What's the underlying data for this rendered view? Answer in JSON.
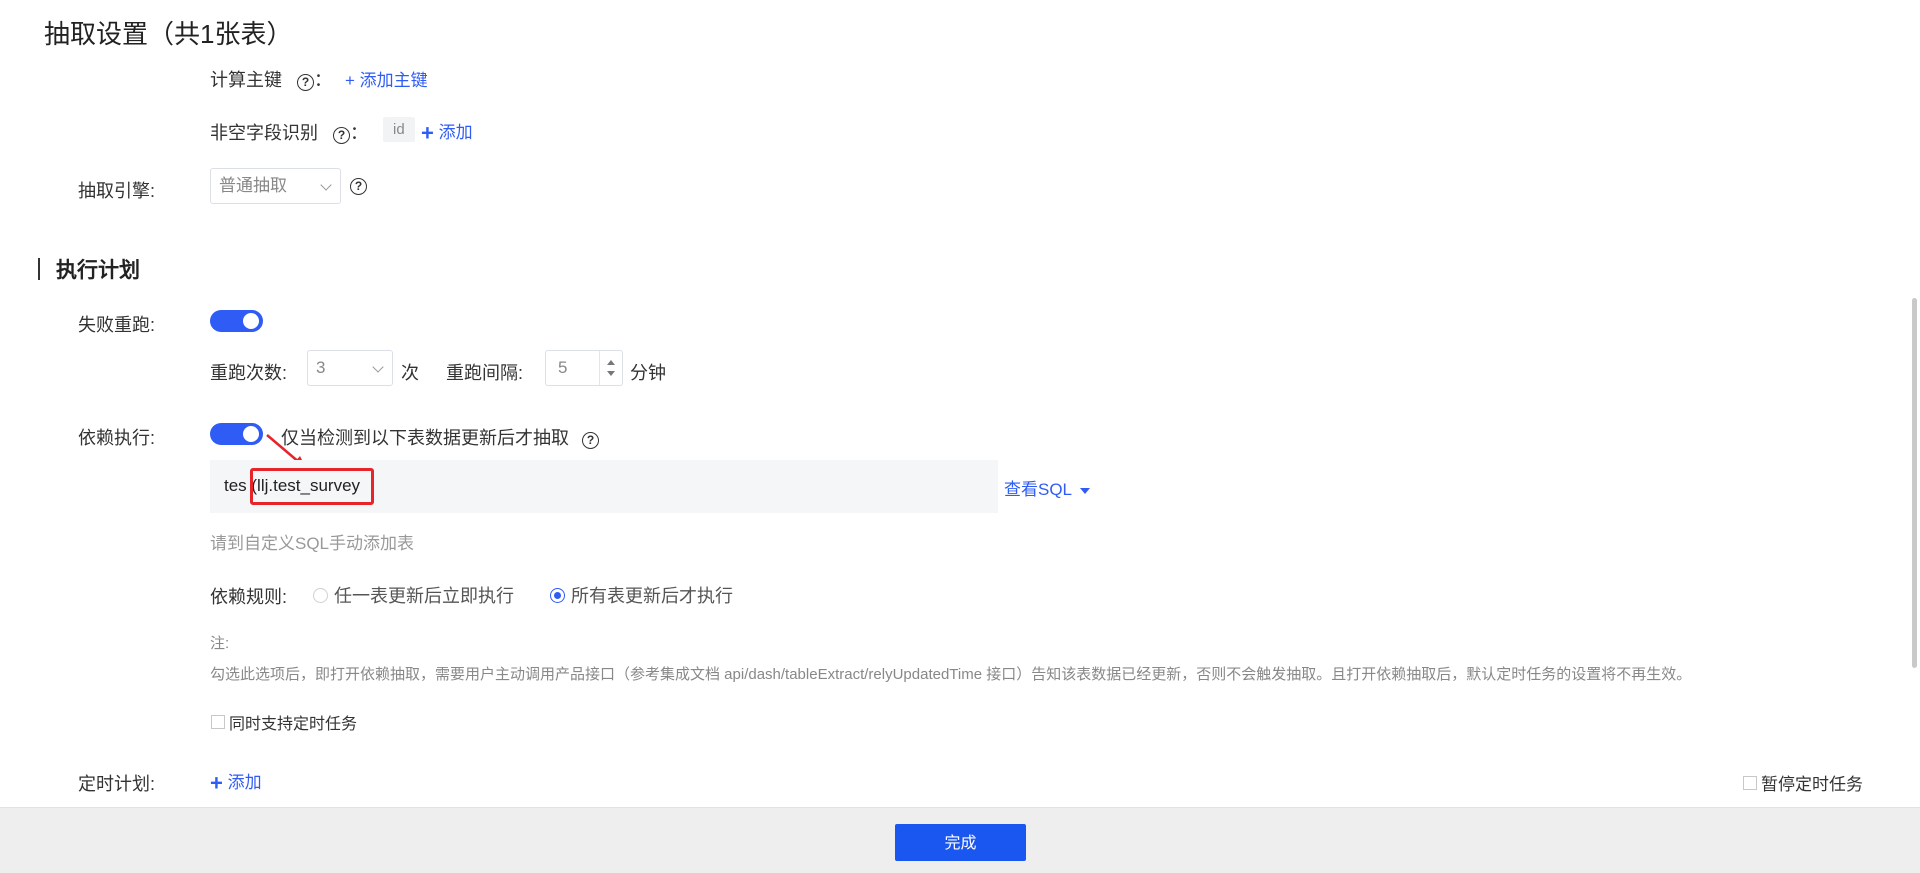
{
  "title": "抽取设置（共1张表）",
  "primary_key": {
    "label": "计算主键",
    "colon": "：",
    "add_label": "+ 添加主键"
  },
  "nonnull": {
    "label": "非空字段识别",
    "colon": "：",
    "tag": "id",
    "add_label": "添加"
  },
  "engine": {
    "label": "抽取引擎:",
    "value": "普通抽取"
  },
  "exec_plan": {
    "title": "执行计划"
  },
  "retry": {
    "label": "失败重跑:",
    "count_label": "重跑次数:",
    "count_value": "3",
    "count_unit": "次",
    "interval_label": "重跑间隔:",
    "interval_value": "5",
    "interval_unit": "分钟"
  },
  "depend": {
    "label": "依赖执行:",
    "desc": "仅当检测到以下表数据更新后才抽取",
    "sql_text": "tes (llj.test_survey",
    "view_sql": "查看SQL",
    "hint": "请到自定义SQL手动添加表",
    "rule_label": "依赖规则:",
    "rule_any": "任一表更新后立即执行",
    "rule_all": "所有表更新后才执行",
    "note_title": "注:",
    "note_text": "勾选此选项后，即打开依赖抽取，需要用户主动调用产品接口（参考集成文档 api/dash/tableExtract/relyUpdatedTime 接口）告知该表数据已经更新，否则不会触发抽取。且打开依赖抽取后，默认定时任务的设置将不再生效。",
    "also_schedule": "同时支持定时任务"
  },
  "schedule": {
    "label": "定时计划:",
    "add_label": "添加",
    "pause_label": "暂停定时任务"
  },
  "footer": {
    "done_label": "完成"
  },
  "colors": {
    "accent": "#2f5cf5",
    "highlight": "#e6242a",
    "primary_button": "#1a56f0"
  }
}
